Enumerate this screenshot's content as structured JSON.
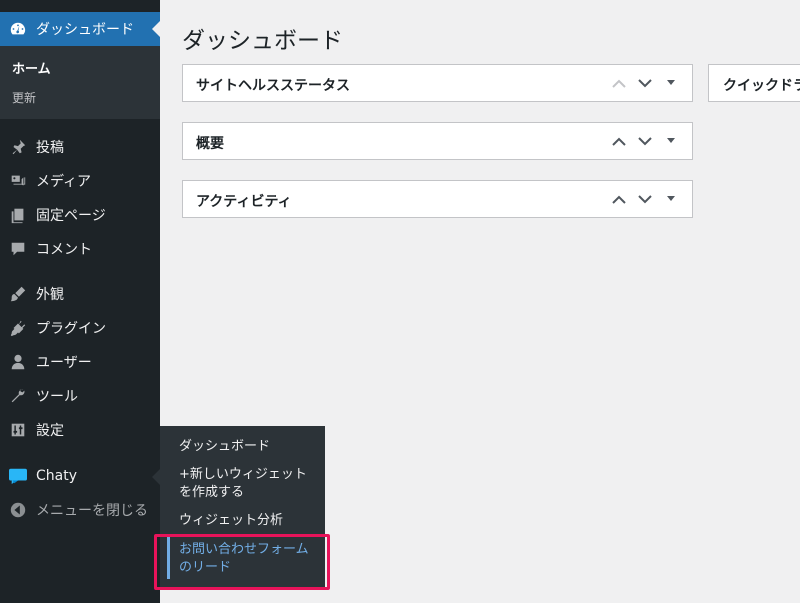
{
  "sidebar": {
    "dashboard_label": "ダッシュボード",
    "sub_home": "ホーム",
    "sub_update": "更新",
    "items": [
      {
        "label": "投稿",
        "icon": "pin-icon"
      },
      {
        "label": "メディア",
        "icon": "media-icon"
      },
      {
        "label": "固定ページ",
        "icon": "page-icon"
      },
      {
        "label": "コメント",
        "icon": "comment-icon"
      },
      {
        "label": "外観",
        "icon": "brush-icon"
      },
      {
        "label": "プラグイン",
        "icon": "plugin-icon"
      },
      {
        "label": "ユーザー",
        "icon": "user-icon"
      },
      {
        "label": "ツール",
        "icon": "wrench-icon"
      },
      {
        "label": "設定",
        "icon": "settings-icon"
      },
      {
        "label": "Chaty",
        "icon": "chaty-icon"
      },
      {
        "label": "メニューを閉じる",
        "icon": "collapse-icon"
      }
    ]
  },
  "flyout": {
    "items": [
      "ダッシュボード",
      "+新しいウィジェット",
      "を作成する",
      "ウィジェット分析",
      "お問い合わせフォーム",
      "のリード"
    ]
  },
  "main": {
    "title": "ダッシュボード",
    "boxes": [
      "サイトヘルスステータス",
      "概要",
      "アクティビティ"
    ],
    "quick_box": "クイックドラフト"
  },
  "colors": {
    "sidebar_bg": "#1d2327",
    "active_bg": "#2271b1",
    "highlight": "#e8135a",
    "link_active": "#72aee6"
  }
}
